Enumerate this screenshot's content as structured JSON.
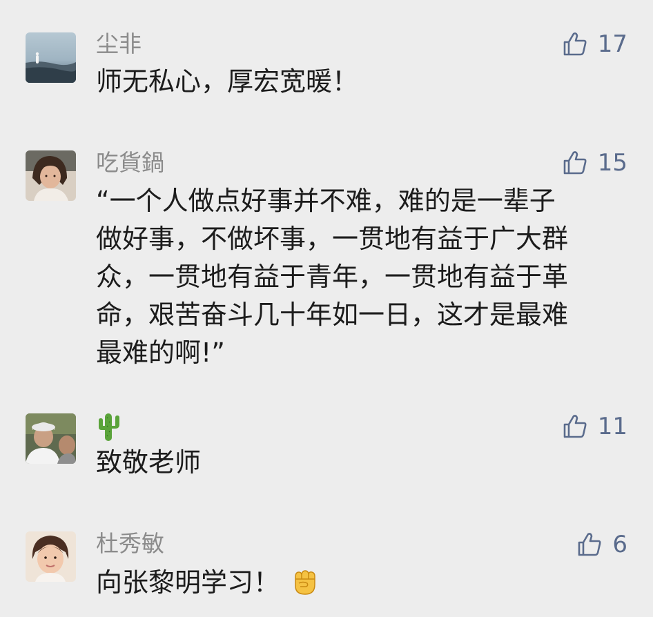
{
  "comments": [
    {
      "name": "尘非",
      "text_lines": [
        "师无私心，厚宏宽暖！"
      ],
      "likes": "17",
      "avatar_icon": "avatar-misty-field-photo"
    },
    {
      "name": "吃貨鍋",
      "text_lines": [
        "“一个人做点好事并不难，难的是一辈子",
        "做好事，不做坏事，一贯地有益于广大群",
        "众，一贯地有益于青年，一贯地有益于革",
        "命，艰苦奋斗几十年如一日，这才是最难",
        "最难的啊!”"
      ],
      "likes": "15",
      "avatar_icon": "avatar-child-photo"
    },
    {
      "name_icon": "cactus-emoji",
      "text_lines": [
        "致敬老师"
      ],
      "likes": "11",
      "avatar_icon": "avatar-two-men-photo"
    },
    {
      "name": "杜秀敏",
      "text_lines": [
        "向张黎明学习！"
      ],
      "trailing_icon": "raised-fist-emoji",
      "likes": "6",
      "avatar_icon": "avatar-girl-portrait-photo"
    }
  ],
  "colors": {
    "background": "#ededed",
    "name": "#8b8b8b",
    "text": "#1c1c1c",
    "like": "#5a6b8c"
  },
  "like_icon": "thumbs-up-icon"
}
